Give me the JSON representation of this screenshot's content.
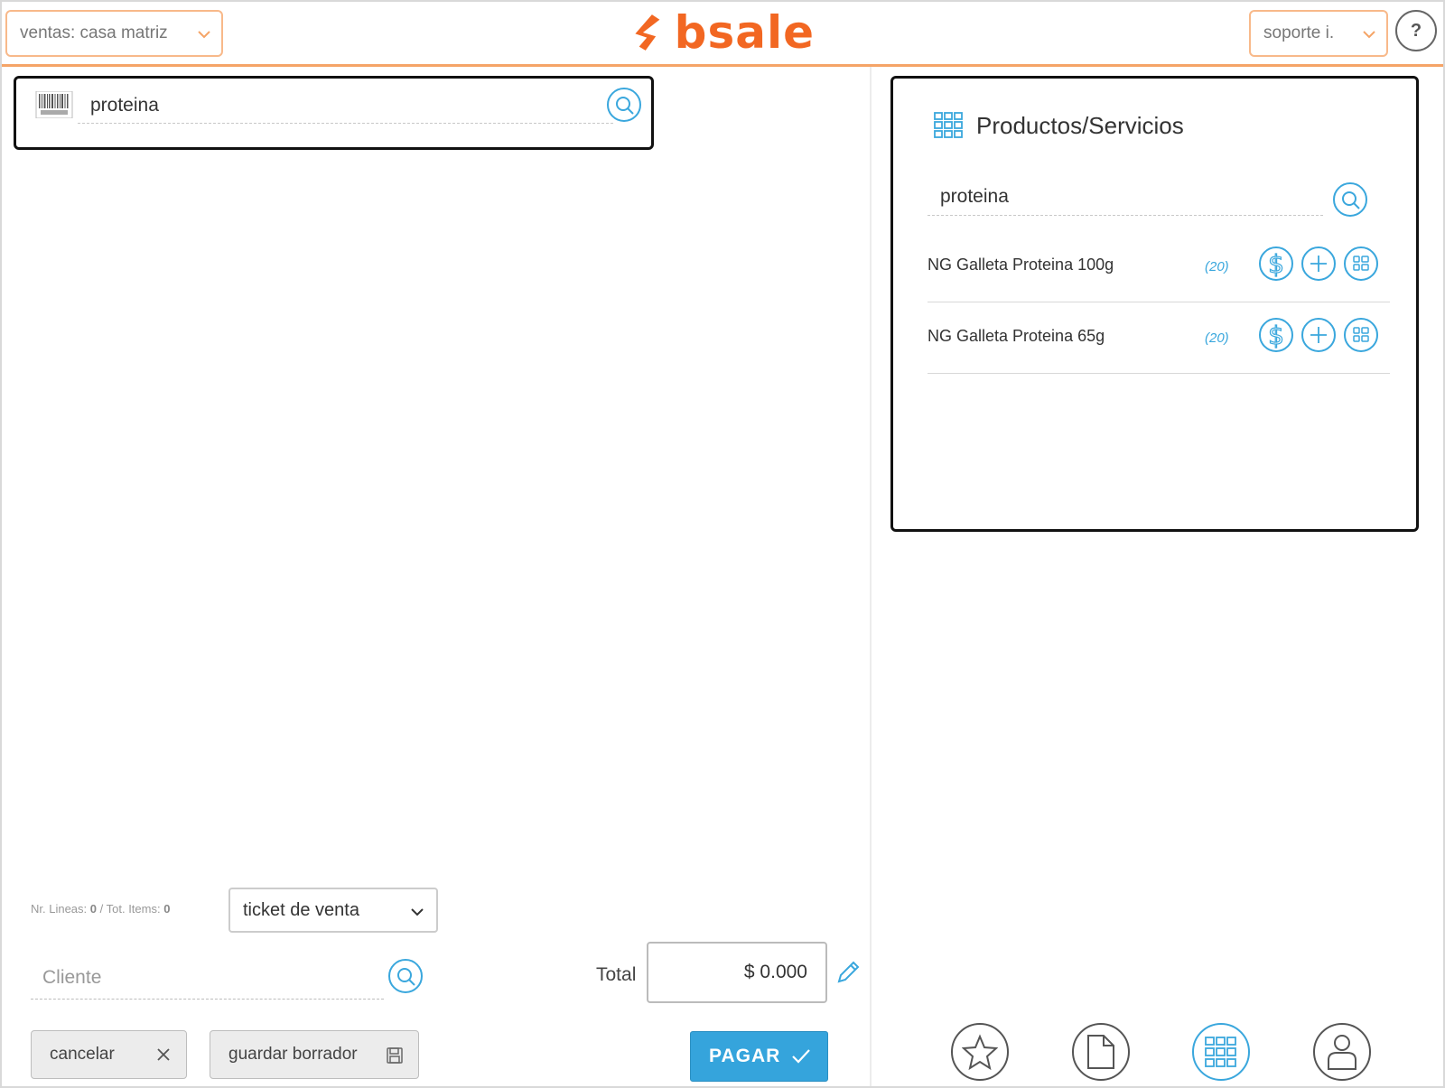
{
  "header": {
    "branch_select": "ventas: casa matriz",
    "user_select": "soporte i.",
    "help_label": "?",
    "logo_text": "bsale",
    "brand_color": "#f26722",
    "accent_color": "#35a4dc"
  },
  "left": {
    "barcode_search": {
      "value": "proteina",
      "icon": "barcode-icon"
    },
    "stats": {
      "lines_label": "Nr. Lineas:",
      "lines_value": "0",
      "items_label": "Tot. Items:",
      "items_value": "0"
    },
    "document_type": "ticket de venta",
    "client_placeholder": "Cliente",
    "total_label": "Total",
    "total_value": "$ 0.000",
    "buttons": {
      "cancel": "cancelar",
      "draft": "guardar borrador",
      "pay": "PAGAR"
    }
  },
  "right": {
    "panel_title": "Productos/Servicios",
    "search_value": "proteina",
    "products": [
      {
        "name": "NG Galleta Proteina 100g",
        "qty": "(20)"
      },
      {
        "name": "NG Galleta Proteina 65g",
        "qty": "(20)"
      }
    ],
    "nav": [
      {
        "icon": "star-icon",
        "active": false
      },
      {
        "icon": "document-icon",
        "active": false
      },
      {
        "icon": "grid-icon",
        "active": true
      },
      {
        "icon": "user-icon",
        "active": false
      }
    ]
  }
}
